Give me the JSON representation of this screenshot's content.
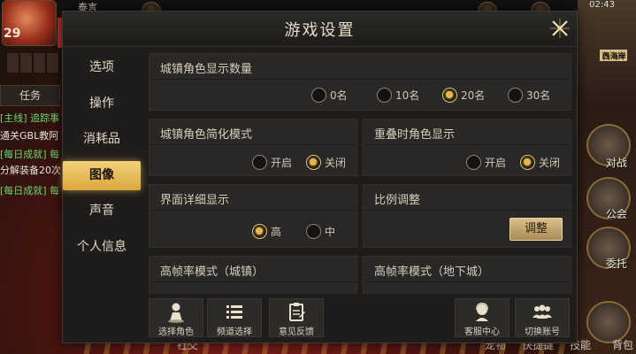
{
  "dialog": {
    "title": "游戏设置",
    "tabs": [
      {
        "label": "选项"
      },
      {
        "label": "操作"
      },
      {
        "label": "消耗品"
      },
      {
        "label": "图像",
        "active": true
      },
      {
        "label": "声音"
      },
      {
        "label": "个人信息"
      }
    ],
    "settings": {
      "town_display": {
        "title": "城镇角色显示数量",
        "options": [
          "0名",
          "10名",
          "20名",
          "30名"
        ],
        "selected": "20名"
      },
      "town_simplify": {
        "title": "城镇角色简化模式",
        "options": [
          "开启",
          "关闭"
        ],
        "selected": "关闭"
      },
      "overlap_display": {
        "title": "重叠时角色显示",
        "options": [
          "开启",
          "关闭"
        ],
        "selected": "关闭"
      },
      "ui_detail": {
        "title": "界面详细显示",
        "options": [
          "高",
          "中"
        ],
        "selected": "高"
      },
      "scale": {
        "title": "比例调整",
        "button_label": "调整"
      },
      "hfr_town": {
        "title": "高帧率模式（城镇）"
      },
      "hfr_dungeon": {
        "title": "高帧率模式（地下城）"
      }
    },
    "footer": [
      {
        "label": "选择角色",
        "icon": "person-icon"
      },
      {
        "label": "频道选择",
        "icon": "list-icon"
      },
      {
        "label": "意见反馈",
        "icon": "clipboard-icon"
      },
      {
        "label": "客服中心",
        "icon": "support-icon"
      },
      {
        "label": "切换账号",
        "icon": "users-icon"
      }
    ]
  },
  "background": {
    "player_name": "泰言",
    "level": "29",
    "time": "02:43",
    "task_tab": "任务",
    "quests": [
      {
        "text": "[主线] 追踪事",
        "color": "green"
      },
      {
        "text": "通关GBL教阿",
        "color": "white"
      },
      {
        "text": "[每日成就] 每",
        "color": "green"
      },
      {
        "text": "分解装备20次",
        "color": "white"
      },
      {
        "text": "[每日成就] 每",
        "color": "green"
      }
    ],
    "right_labels": [
      "对战",
      "公会",
      "委托"
    ],
    "bottom_labels": [
      "社交",
      "宠物",
      "快捷键",
      "技能",
      "背包"
    ],
    "town_sign": "西海岸"
  },
  "colors": {
    "accent_gold": "#e8b64a",
    "tab_active": "#f2d27a",
    "dialog_bg": "#1f1d1b",
    "card_bg": "#2a2826"
  }
}
